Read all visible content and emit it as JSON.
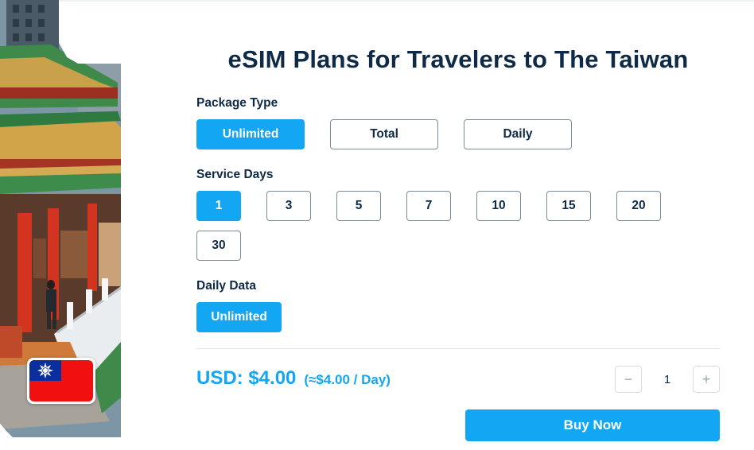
{
  "title": "eSIM Plans for Travelers to The Taiwan",
  "photo": {
    "subject": "taiwan-temple-photo",
    "flag": "taiwan-flag-icon"
  },
  "package_type": {
    "label": "Package Type",
    "options": [
      "Unlimited",
      "Total",
      "Daily"
    ],
    "selected": "Unlimited"
  },
  "service_days": {
    "label": "Service Days",
    "options": [
      "1",
      "3",
      "5",
      "7",
      "10",
      "15",
      "20",
      "30"
    ],
    "selected": "1"
  },
  "daily_data": {
    "label": "Daily Data",
    "options": [
      "Unlimited"
    ],
    "selected": "Unlimited"
  },
  "price": {
    "main": "USD: $4.00",
    "per_day": "(≈$4.00 / Day)"
  },
  "quantity": {
    "value": "1",
    "minus": "−",
    "plus": "+"
  },
  "buy_button": "Buy Now",
  "colors": {
    "accent": "#13a6f3",
    "text": "#0e2a47",
    "border": "#7c8c99"
  }
}
